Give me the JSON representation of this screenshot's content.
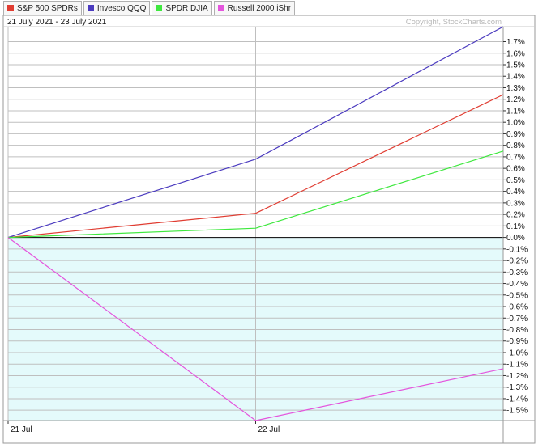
{
  "chart_data": {
    "type": "line",
    "date_range": "21 July 2021 - 23 July 2021",
    "copyright": "Copyright, StockCharts.com",
    "x": [
      0,
      1,
      2
    ],
    "x_tick_labels": [
      {
        "x": 0,
        "label": "21 Jul"
      },
      {
        "x": 1,
        "label": "22 Jul"
      }
    ],
    "xlim": [
      0,
      2
    ],
    "ylim": [
      -1.59,
      1.83
    ],
    "y_ticks": [
      1.7,
      1.6,
      1.5,
      1.4,
      1.3,
      1.2,
      1.1,
      1.0,
      0.9,
      0.8,
      0.7,
      0.6,
      0.5,
      0.4,
      0.3,
      0.2,
      0.1,
      0.0,
      -0.1,
      -0.2,
      -0.3,
      -0.4,
      -0.5,
      -0.6,
      -0.7,
      -0.8,
      -0.9,
      -1.0,
      -1.1,
      -1.2,
      -1.3,
      -1.4,
      -1.5
    ],
    "y_tick_labels": [
      "1.7%",
      "1.6%",
      "1.5%",
      "1.4%",
      "1.3%",
      "1.2%",
      "1.1%",
      "1.0%",
      "0.9%",
      "0.8%",
      "0.7%",
      "0.6%",
      "0.5%",
      "0.4%",
      "0.3%",
      "0.2%",
      "0.1%",
      "0.0%",
      "-0.1%",
      "-0.2%",
      "-0.3%",
      "-0.4%",
      "-0.5%",
      "-0.6%",
      "-0.7%",
      "-0.8%",
      "-0.9%",
      "-1.0%",
      "-1.1%",
      "-1.2%",
      "-1.3%",
      "-1.4%",
      "-1.5%"
    ],
    "grid": true,
    "legend_position": "top-left",
    "colors": {
      "positive_fill": "#ffffff",
      "negative_fill": "#e4fafb",
      "grid": "#bfbfbf",
      "zero_line": "#000000"
    },
    "series": [
      {
        "name": "S&P 500 SPDRs",
        "color": "#e03c31",
        "values": [
          0.0,
          0.21,
          1.24
        ]
      },
      {
        "name": "Invesco QQQ",
        "color": "#4b3bbf",
        "values": [
          0.0,
          0.68,
          1.83
        ]
      },
      {
        "name": "SPDR DJIA",
        "color": "#3ee83e",
        "values": [
          0.0,
          0.08,
          0.75
        ]
      },
      {
        "name": "Russell 2000 iShr",
        "color": "#e455dd",
        "values": [
          0.0,
          -1.59,
          -1.14
        ]
      }
    ]
  }
}
